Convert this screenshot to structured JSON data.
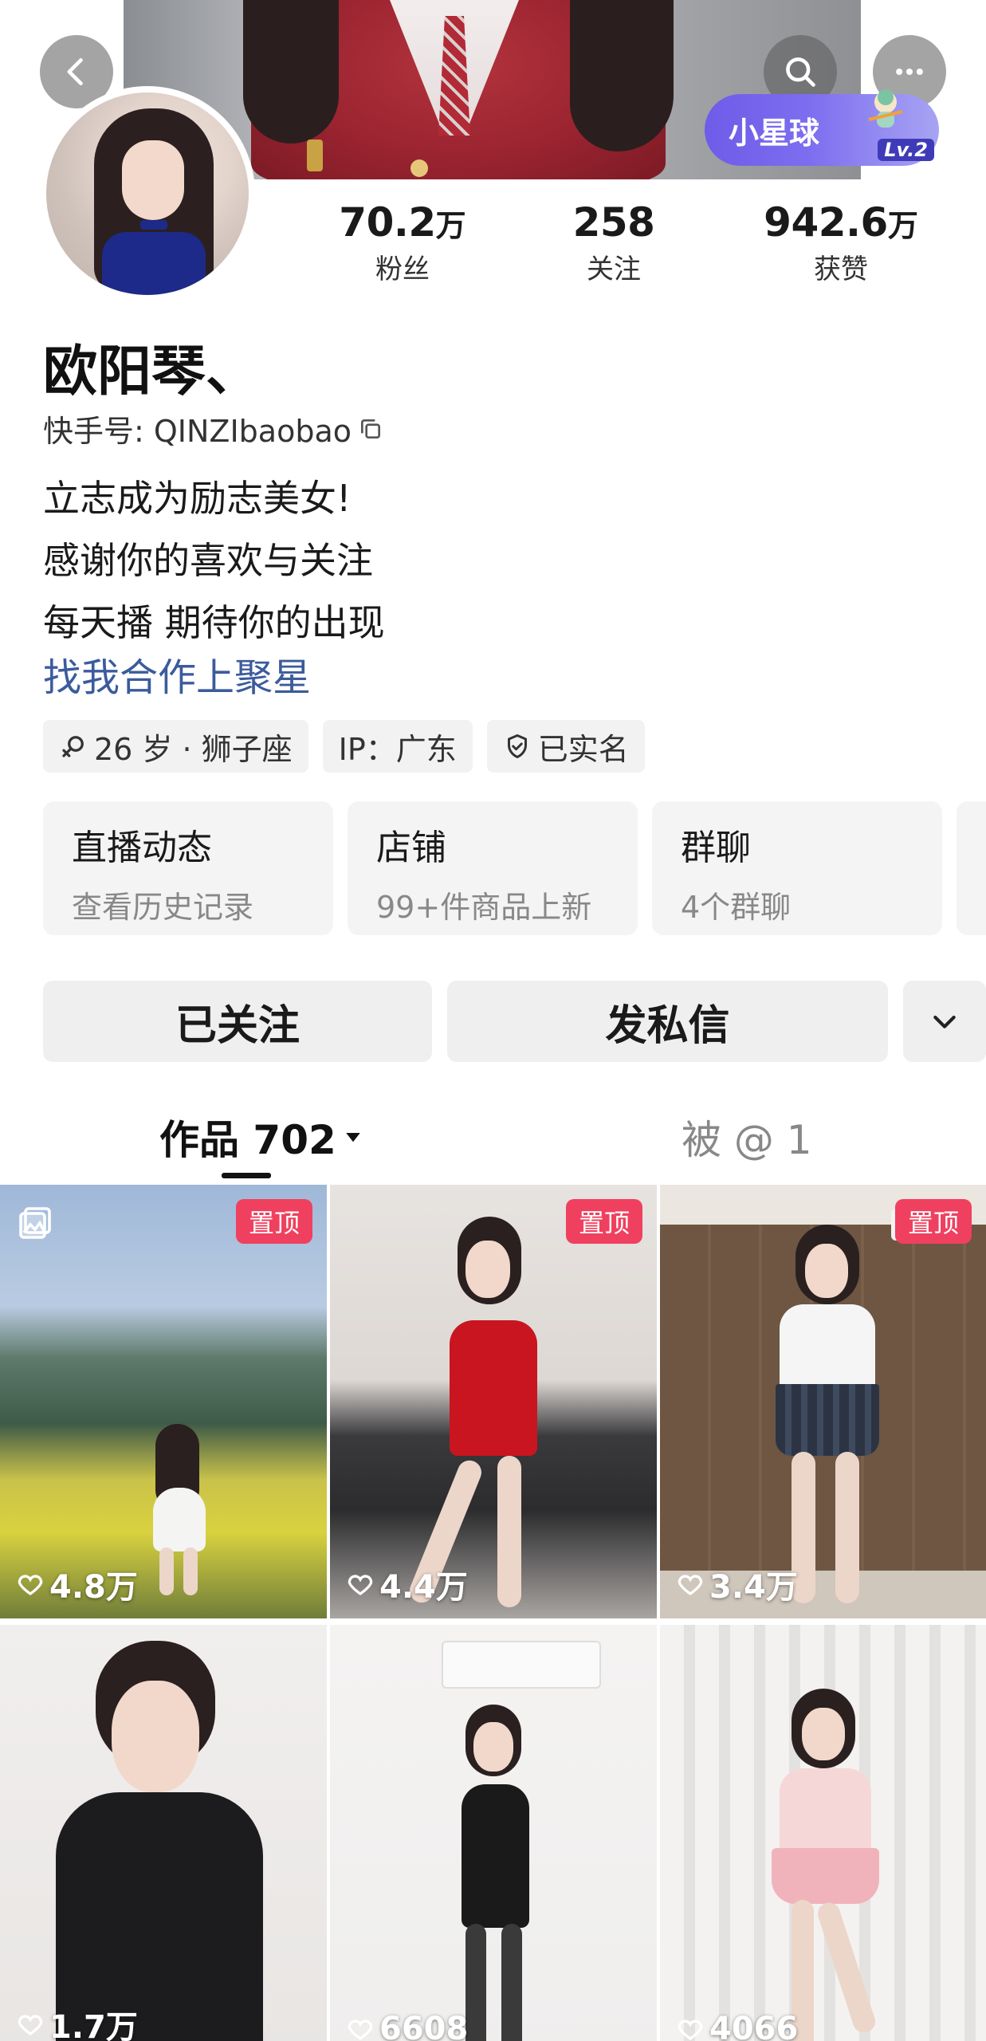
{
  "header": {
    "planet_badge": {
      "label": "小星球",
      "level": "Lv.2"
    }
  },
  "profile": {
    "name": "欧阳琴、",
    "kwai_id": "快手号: QINZIbaobao",
    "bio_lines": [
      "立志成为励志美女!",
      "感谢你的喜欢与关注",
      "每天播 期待你的出现"
    ],
    "bio_link": "找我合作上聚星"
  },
  "stats": {
    "fans": {
      "value": "70.2",
      "unit": "万",
      "label": "粉丝"
    },
    "following": {
      "value": "258",
      "unit": "",
      "label": "关注"
    },
    "likes": {
      "value": "942.6",
      "unit": "万",
      "label": "获赞"
    }
  },
  "tags": [
    {
      "icon": "gender-female-icon",
      "text": "26 岁 · 狮子座"
    },
    {
      "icon": "",
      "text": "IP：广东"
    },
    {
      "icon": "shield-check-icon",
      "text": "已实名"
    }
  ],
  "feature_cards": [
    {
      "title": "直播动态",
      "subtitle": "查看历史记录"
    },
    {
      "title": "店铺",
      "subtitle": "99+件商品上新"
    },
    {
      "title": "群聊",
      "subtitle": "4个群聊"
    }
  ],
  "actions": {
    "follow_label": "已关注",
    "message_label": "发私信"
  },
  "tabs": {
    "works": "作品 702",
    "mentions": "被 @ 1"
  },
  "videos": [
    {
      "pinned": true,
      "pin_label": "置顶",
      "likes": "4.8万",
      "album": true
    },
    {
      "pinned": true,
      "pin_label": "置顶",
      "likes": "4.4万",
      "album": false
    },
    {
      "pinned": true,
      "pin_label": "置顶",
      "likes": "3.4万",
      "album": false
    },
    {
      "pinned": false,
      "pin_label": "",
      "likes": "1.7万",
      "album": false
    },
    {
      "pinned": false,
      "pin_label": "",
      "likes": "6608",
      "album": false
    },
    {
      "pinned": false,
      "pin_label": "",
      "likes": "4066",
      "album": false
    }
  ],
  "colors": {
    "pin_badge": "#f0405f",
    "link": "#3b5b9c",
    "planet_badge": "#6f5be8"
  }
}
